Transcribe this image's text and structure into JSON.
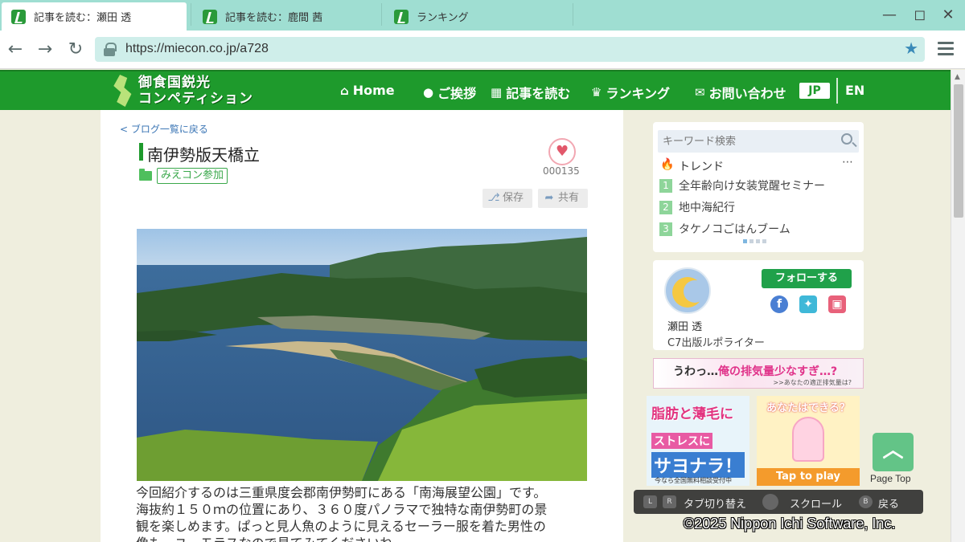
{
  "browser": {
    "tabs": [
      {
        "label": "記事を読む：瀬田 透",
        "active": true
      },
      {
        "label": "記事を読む：鹿間 茜",
        "active": false
      },
      {
        "label": "ランキング",
        "active": false
      }
    ],
    "url": "https://miecon.co.jp/a728"
  },
  "site": {
    "logo": {
      "line1": "御食国鋭光",
      "line2": "コンペティション"
    },
    "nav": {
      "home": "Home",
      "greeting": "ご挨拶",
      "read": "記事を読む",
      "ranking": "ランキング",
      "contact": "お問い合わせ",
      "lang_jp": "JP",
      "lang_en": "EN"
    }
  },
  "article": {
    "back_link": "< ブログ一覧に戻る",
    "title": "南伊勢版天橋立",
    "category": "みえコン参加",
    "like_count": "000135",
    "save_label": "保存",
    "share_label": "共有",
    "body": "今回紹介するのは三重県度会郡南伊勢町にある「南海展望公園」です。海抜約１５０ｍの位置にあり、３６０度パノラマで独特な南伊勢町の景観を楽しめます。ぱっと見人魚のように見えるセーラー服を着た男性の像も。ユーモラスなので見てみてくださいね"
  },
  "sidebar": {
    "search_placeholder": "キーワード検索",
    "trend_title": "トレンド",
    "trends": [
      {
        "num": "1",
        "label": "全年齢向け女装覚醒セミナー"
      },
      {
        "num": "2",
        "label": "地中海紀行"
      },
      {
        "num": "3",
        "label": "タケノコごはんブーム"
      }
    ],
    "author": {
      "follow_label": "フォローする",
      "name": "瀬田 透",
      "role": "C7出版ルポライター"
    },
    "banner_wide": {
      "text_a": "うわっ…",
      "text_b": "俺の排気量少なすぎ…?",
      "sub": ">>あなたの適正排気量は?"
    },
    "ad_left": {
      "line1": "脂肪と薄毛に",
      "line2": "ストレスに",
      "line3": "サヨナラ！",
      "line4": "今なら全国無料相談受付中"
    },
    "ad_right": {
      "question": "あなたはできる？",
      "cta": "Tap to play"
    },
    "page_top": "Page Top"
  },
  "overlay": {
    "key_l": "L",
    "key_r": "R",
    "tab_switch": "タブ切り替え",
    "scroll": "スクロール",
    "key_b": "B",
    "back": "戻る",
    "copyright": "©2025 Nippon Ichi Software, Inc."
  },
  "colors": {
    "brand_green": "#1e9a2c",
    "tab_bar": "#9fded2",
    "url_bar": "#cfeeea",
    "link_blue": "#3b76b5"
  }
}
